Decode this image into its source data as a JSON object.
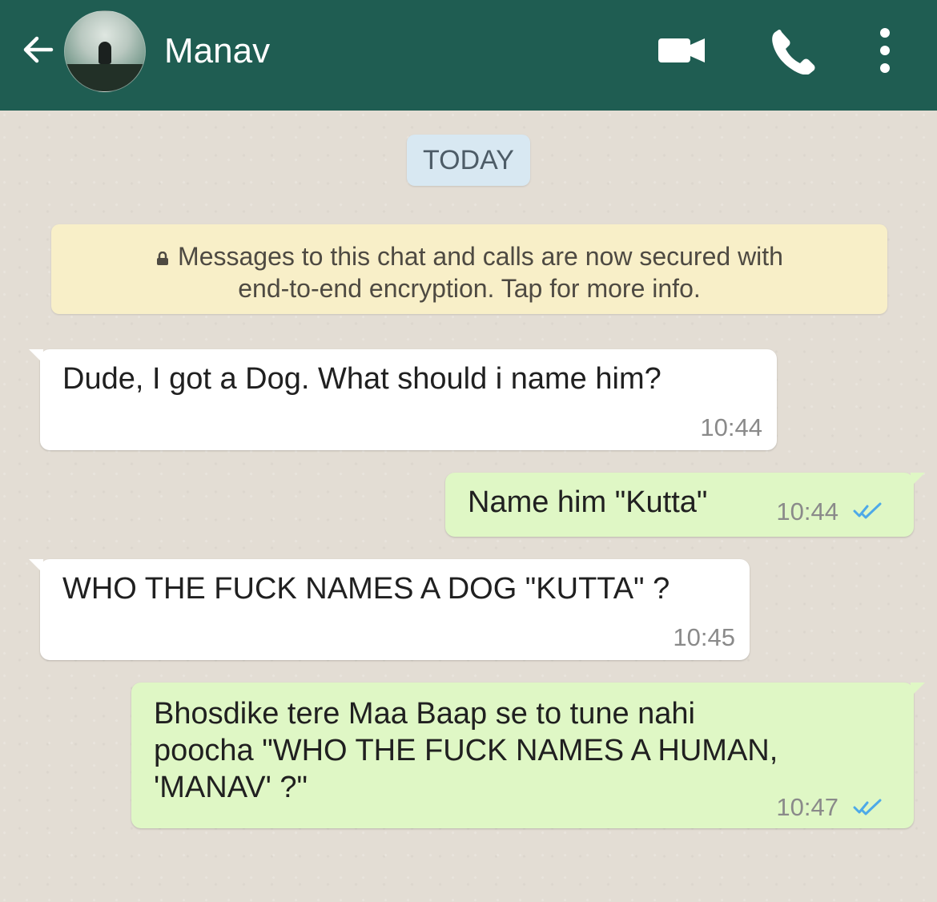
{
  "header": {
    "contact_name": "Manav",
    "back_icon": "arrow-left-icon",
    "video_icon": "video-call-icon",
    "phone_icon": "phone-icon",
    "more_icon": "more-vertical-icon",
    "colors": {
      "header": "#1f5d52",
      "text": "#ffffff"
    }
  },
  "chat": {
    "date_label": "TODAY",
    "security_notice": {
      "line1": "Messages to this chat and calls are now secured with",
      "line2": "end-to-end encryption. Tap for more info."
    },
    "messages": [
      {
        "direction": "incoming",
        "text": "Dude, I got a Dog. What should i name him?",
        "time": "10:44"
      },
      {
        "direction": "outgoing",
        "text": "Name him \"Kutta\"",
        "time": "10:44",
        "status": "read"
      },
      {
        "direction": "incoming",
        "text": "WHO THE FUCK NAMES A DOG \"KUTTA\" ?",
        "time": "10:45"
      },
      {
        "direction": "outgoing",
        "text": "Bhosdike tere Maa Baap se to tune nahi\npoocha \"WHO THE FUCK NAMES A HUMAN,\n'MANAV' ?\"",
        "time": "10:47",
        "status": "read"
      }
    ],
    "colors": {
      "background": "#e3ddd4",
      "incoming_bubble": "#ffffff",
      "outgoing_bubble": "#dff7c5",
      "date_badge": "#d8e8f2",
      "security_notice": "#f8efc8",
      "read_ticks": "#4da9e8"
    }
  }
}
